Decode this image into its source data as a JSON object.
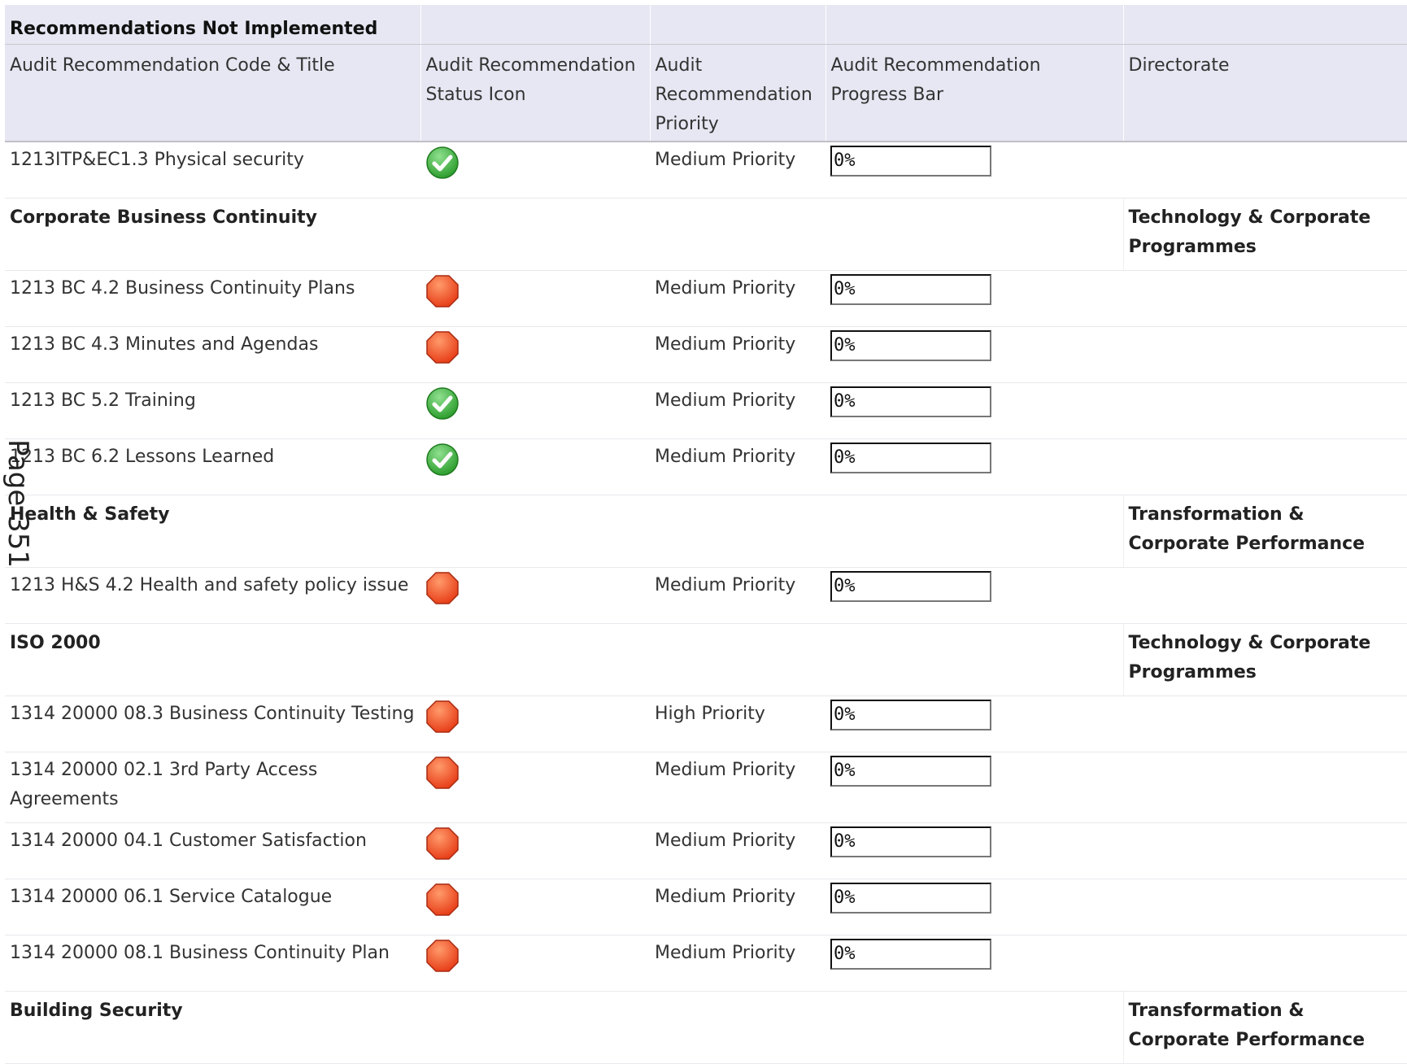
{
  "report": {
    "title": "Recommendations Not Implemented",
    "columns": [
      "Audit Recommendation Code & Title",
      "Audit Recommendation Status Icon",
      "Audit Recommendation Priority",
      "Audit Recommendation Progress Bar",
      "Directorate"
    ],
    "rows": [
      {
        "kind": "rec",
        "code_title": "1213ITP&EC1.3 Physical security",
        "status": "complete",
        "status_icon": "green-check-icon",
        "priority": "Medium Priority",
        "progress_label": "0%",
        "progress": 0
      },
      {
        "kind": "group",
        "name": "Corporate Business Continuity",
        "directorate": "Technology & Corporate Programmes"
      },
      {
        "kind": "rec",
        "code_title": "1213 BC 4.2 Business Continuity Plans",
        "status": "not-implemented",
        "status_icon": "red-stop-icon",
        "priority": "Medium Priority",
        "progress_label": "0%",
        "progress": 0
      },
      {
        "kind": "rec",
        "code_title": "1213 BC 4.3 Minutes and Agendas",
        "status": "not-implemented",
        "status_icon": "red-stop-icon",
        "priority": "Medium Priority",
        "progress_label": "0%",
        "progress": 0
      },
      {
        "kind": "rec",
        "code_title": "1213 BC 5.2 Training",
        "status": "complete",
        "status_icon": "green-check-icon",
        "priority": "Medium Priority",
        "progress_label": "0%",
        "progress": 0
      },
      {
        "kind": "rec",
        "code_title": "1213 BC 6.2 Lessons Learned",
        "status": "complete",
        "status_icon": "green-check-icon",
        "priority": "Medium Priority",
        "progress_label": "0%",
        "progress": 0
      },
      {
        "kind": "group",
        "name": "Health & Safety",
        "directorate": "Transformation & Corporate Performance"
      },
      {
        "kind": "rec",
        "code_title": "1213 H&S 4.2 Health and safety policy issue",
        "status": "not-implemented",
        "status_icon": "red-stop-icon",
        "priority": "Medium Priority",
        "progress_label": "0%",
        "progress": 0
      },
      {
        "kind": "group",
        "name": "ISO 2000",
        "directorate": "Technology & Corporate Programmes"
      },
      {
        "kind": "rec",
        "code_title": "1314 20000 08.3 Business Continuity Testing",
        "status": "not-implemented",
        "status_icon": "red-stop-icon",
        "priority": "High Priority",
        "progress_label": "0%",
        "progress": 0
      },
      {
        "kind": "rec",
        "code_title": "1314 20000 02.1 3rd Party Access Agreements",
        "status": "not-implemented",
        "status_icon": "red-stop-icon",
        "priority": "Medium Priority",
        "progress_label": "0%",
        "progress": 0
      },
      {
        "kind": "rec",
        "code_title": "1314 20000 04.1 Customer Satisfaction",
        "status": "not-implemented",
        "status_icon": "red-stop-icon",
        "priority": "Medium Priority",
        "progress_label": "0%",
        "progress": 0
      },
      {
        "kind": "rec",
        "code_title": "1314 20000 06.1 Service Catalogue",
        "status": "not-implemented",
        "status_icon": "red-stop-icon",
        "priority": "Medium Priority",
        "progress_label": "0%",
        "progress": 0
      },
      {
        "kind": "rec",
        "code_title": "1314 20000 08.1 Business Continuity Plan",
        "status": "not-implemented",
        "status_icon": "red-stop-icon",
        "priority": "Medium Priority",
        "progress_label": "0%",
        "progress": 0
      },
      {
        "kind": "group",
        "name": "Building Security",
        "directorate": "Transformation & Corporate Performance"
      }
    ]
  },
  "page_stamp": "Page 351",
  "colors": {
    "header_bg": "#e6e7f2",
    "status_green": "#2e9e2e",
    "status_red": "#e8401a",
    "progress_fill": "#7aa7d9"
  }
}
